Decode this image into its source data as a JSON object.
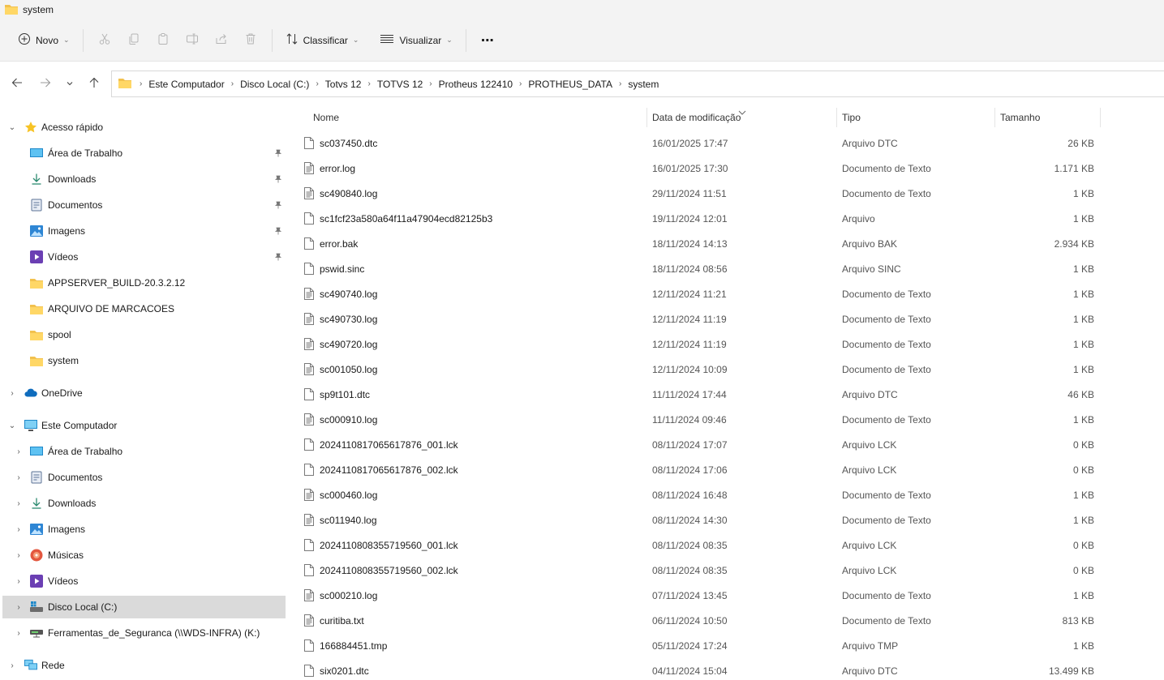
{
  "window": {
    "title": "system"
  },
  "toolbar": {
    "new_label": "Novo",
    "sort_label": "Classificar",
    "view_label": "Visualizar",
    "more_label": "⋯"
  },
  "address": {
    "crumbs": [
      "Este Computador",
      "Disco Local (C:)",
      "Totvs 12",
      "TOTVS 12",
      "Protheus 122410",
      "PROTHEUS_DATA",
      "system"
    ]
  },
  "sidebar": {
    "quick_access": "Acesso rápido",
    "quick_items": [
      "Área de Trabalho",
      "Downloads",
      "Documentos",
      "Imagens",
      "Vídeos",
      "APPSERVER_BUILD-20.3.2.12",
      "ARQUIVO DE MARCACOES",
      "spool",
      "system"
    ],
    "onedrive": "OneDrive",
    "this_pc": "Este Computador",
    "pc_items": [
      "Área de Trabalho",
      "Documentos",
      "Downloads",
      "Imagens",
      "Músicas",
      "Vídeos",
      "Disco Local (C:)",
      "Ferramentas_de_Seguranca (\\\\WDS-INFRA) (K:)"
    ],
    "network": "Rede"
  },
  "columns": {
    "name": "Nome",
    "date": "Data de modificação",
    "type": "Tipo",
    "size": "Tamanho"
  },
  "files": [
    {
      "name": "sc037450.dtc",
      "date": "16/01/2025 17:47",
      "type": "Arquivo DTC",
      "size": "26 KB",
      "icon": "blank"
    },
    {
      "name": "error.log",
      "date": "16/01/2025 17:30",
      "type": "Documento de Texto",
      "size": "1.171 KB",
      "icon": "text"
    },
    {
      "name": "sc490840.log",
      "date": "29/11/2024 11:51",
      "type": "Documento de Texto",
      "size": "1 KB",
      "icon": "text"
    },
    {
      "name": "sc1fcf23a580a64f11a47904ecd82125b3",
      "date": "19/11/2024 12:01",
      "type": "Arquivo",
      "size": "1 KB",
      "icon": "blank"
    },
    {
      "name": "error.bak",
      "date": "18/11/2024 14:13",
      "type": "Arquivo BAK",
      "size": "2.934 KB",
      "icon": "blank"
    },
    {
      "name": "pswid.sinc",
      "date": "18/11/2024 08:56",
      "type": "Arquivo SINC",
      "size": "1 KB",
      "icon": "blank"
    },
    {
      "name": "sc490740.log",
      "date": "12/11/2024 11:21",
      "type": "Documento de Texto",
      "size": "1 KB",
      "icon": "text"
    },
    {
      "name": "sc490730.log",
      "date": "12/11/2024 11:19",
      "type": "Documento de Texto",
      "size": "1 KB",
      "icon": "text"
    },
    {
      "name": "sc490720.log",
      "date": "12/11/2024 11:19",
      "type": "Documento de Texto",
      "size": "1 KB",
      "icon": "text"
    },
    {
      "name": "sc001050.log",
      "date": "12/11/2024 10:09",
      "type": "Documento de Texto",
      "size": "1 KB",
      "icon": "text"
    },
    {
      "name": "sp9t101.dtc",
      "date": "11/11/2024 17:44",
      "type": "Arquivo DTC",
      "size": "46 KB",
      "icon": "blank"
    },
    {
      "name": "sc000910.log",
      "date": "11/11/2024 09:46",
      "type": "Documento de Texto",
      "size": "1 KB",
      "icon": "text"
    },
    {
      "name": "2024110817065617876_001.lck",
      "date": "08/11/2024 17:07",
      "type": "Arquivo LCK",
      "size": "0 KB",
      "icon": "blank"
    },
    {
      "name": "2024110817065617876_002.lck",
      "date": "08/11/2024 17:06",
      "type": "Arquivo LCK",
      "size": "0 KB",
      "icon": "blank"
    },
    {
      "name": "sc000460.log",
      "date": "08/11/2024 16:48",
      "type": "Documento de Texto",
      "size": "1 KB",
      "icon": "text"
    },
    {
      "name": "sc011940.log",
      "date": "08/11/2024 14:30",
      "type": "Documento de Texto",
      "size": "1 KB",
      "icon": "text"
    },
    {
      "name": "2024110808355719560_001.lck",
      "date": "08/11/2024 08:35",
      "type": "Arquivo LCK",
      "size": "0 KB",
      "icon": "blank"
    },
    {
      "name": "2024110808355719560_002.lck",
      "date": "08/11/2024 08:35",
      "type": "Arquivo LCK",
      "size": "0 KB",
      "icon": "blank"
    },
    {
      "name": "sc000210.log",
      "date": "07/11/2024 13:45",
      "type": "Documento de Texto",
      "size": "1 KB",
      "icon": "text"
    },
    {
      "name": "curitiba.txt",
      "date": "06/11/2024 10:50",
      "type": "Documento de Texto",
      "size": "813 KB",
      "icon": "text"
    },
    {
      "name": "166884451.tmp",
      "date": "05/11/2024 17:24",
      "type": "Arquivo TMP",
      "size": "1 KB",
      "icon": "blank"
    },
    {
      "name": "six0201.dtc",
      "date": "04/11/2024 15:04",
      "type": "Arquivo DTC",
      "size": "13.499 KB",
      "icon": "blank"
    }
  ]
}
